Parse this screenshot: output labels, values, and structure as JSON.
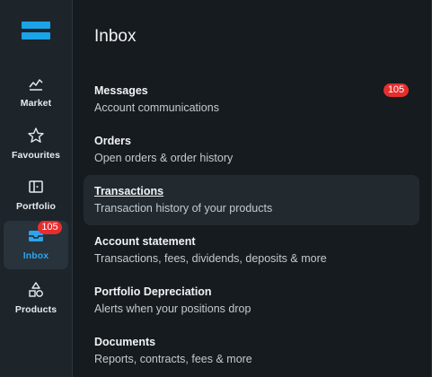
{
  "sidebar": {
    "items": [
      {
        "label": "Market",
        "icon": "market-chart-icon"
      },
      {
        "label": "Favourites",
        "icon": "star-icon"
      },
      {
        "label": "Portfolio",
        "icon": "portfolio-icon"
      },
      {
        "label": "Inbox",
        "icon": "inbox-icon",
        "badge": "105",
        "active": true
      },
      {
        "label": "Products",
        "icon": "products-shapes-icon"
      }
    ]
  },
  "panel": {
    "title": "Inbox",
    "items": [
      {
        "title": "Messages",
        "subtitle": "Account communications",
        "badge": "105"
      },
      {
        "title": "Orders",
        "subtitle": "Open orders & order history"
      },
      {
        "title": "Transactions",
        "subtitle": "Transaction history of your products",
        "hovered": true
      },
      {
        "title": "Account statement",
        "subtitle": "Transactions, fees, dividends, deposits & more"
      },
      {
        "title": "Portfolio Depreciation",
        "subtitle": "Alerts when your positions drop"
      },
      {
        "title": "Documents",
        "subtitle": "Reports, contracts, fees & more"
      }
    ]
  },
  "colors": {
    "accent": "#2ea4ec",
    "badge": "#e62e2e"
  }
}
